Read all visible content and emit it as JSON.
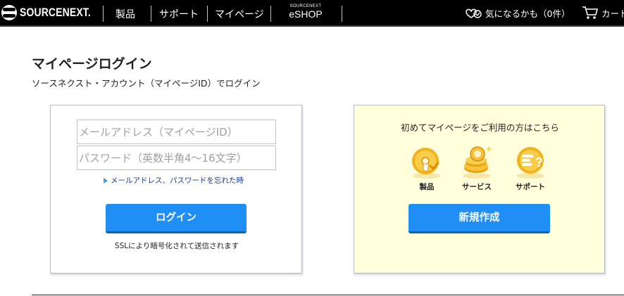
{
  "header": {
    "brand": "SOURCENEXT.",
    "nav": [
      "製品",
      "サポート",
      "マイページ"
    ],
    "eshop_small": "SOURCENEXT",
    "eshop_large": "eSHOP",
    "favorites_label": "気になるかも（0件）",
    "cart_label": "カート"
  },
  "page": {
    "title": "マイページログイン",
    "subtitle": "ソースネクスト・アカウント（マイページID）でログイン"
  },
  "login": {
    "email_placeholder": "メールアドレス（マイページID）",
    "password_placeholder": "パスワード（英数半角4〜16文字）",
    "forgot_link": "メールアドレス、パスワードを忘れた時",
    "login_button": "ログイン",
    "ssl_note": "SSLにより暗号化されて送信されます"
  },
  "register": {
    "heading": "初めてマイページをご利用の方はこちら",
    "features": [
      {
        "label": "製品",
        "icon": "disc-icon"
      },
      {
        "label": "サービス",
        "icon": "coins-icon"
      },
      {
        "label": "サポート",
        "icon": "support-chat-icon"
      }
    ],
    "create_button": "新規作成"
  },
  "colors": {
    "header_bg": "#000000",
    "button_blue": "#1f8ff5",
    "register_bg": "#ffffdc",
    "link_blue": "#1b3a8f",
    "gold": "#f2b21a"
  }
}
